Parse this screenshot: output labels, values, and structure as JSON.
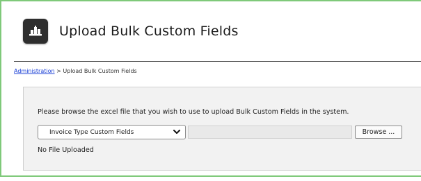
{
  "header": {
    "title": "Upload Bulk Custom Fields",
    "icon": "building-icon"
  },
  "breadcrumb": {
    "link_label": "Administration",
    "separator": " > ",
    "current": "Upload Bulk Custom Fields"
  },
  "upload_panel": {
    "instructions": "Please browse the excel file that you wish to use to upload Bulk Custom Fields in the system.",
    "type_select": {
      "selected": "Invoice Type Custom Fields"
    },
    "file_path": {
      "value": ""
    },
    "browse_label": "Browse ...",
    "status": "No File Uploaded"
  },
  "colors": {
    "frame_border": "#7fc97a",
    "link": "#1a3fd6",
    "panel_bg": "#f2f2f2",
    "icon_bg": "#2e2e2e"
  }
}
